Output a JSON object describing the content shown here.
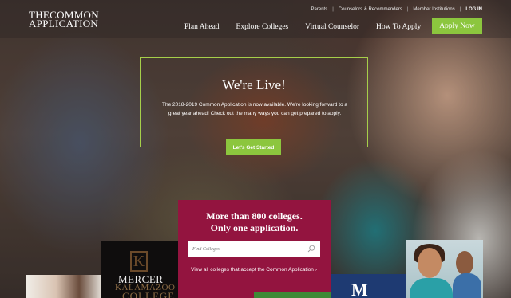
{
  "header": {
    "logo_line1": "THECOMMON",
    "logo_line2": "APPLICATION",
    "utility_links": [
      "Parents",
      "Counselors & Recommenders",
      "Member Institutions"
    ],
    "login_label": "LOG IN",
    "nav": [
      "Plan Ahead",
      "Explore Colleges",
      "Virtual Counselor",
      "How To Apply"
    ],
    "apply_label": "Apply Now"
  },
  "hero": {
    "title": "We're Live!",
    "text": "The 2018-2019 Common Application is now available. We're looking forward to a great year ahead! Check out the many ways you can get prepared to apply.",
    "cta_label": "Let's Get Started"
  },
  "colleges": {
    "headline1": "More than 800 colleges.",
    "headline2": "Only one application.",
    "search_placeholder": "Find Colleges",
    "view_all_label": "View all colleges that accept the Common Application ›"
  },
  "tiles": {
    "mercer_label": "MERCER",
    "kalamazoo_label1": "KALAMAZOO",
    "kalamazoo_label2": "COLLEGE",
    "blue_letter": "M"
  },
  "colors": {
    "accent_green": "#8cc63e",
    "panel_crimson": "#93143f",
    "box_border": "#a6cf4a"
  },
  "icons": {
    "search": "search-icon"
  }
}
